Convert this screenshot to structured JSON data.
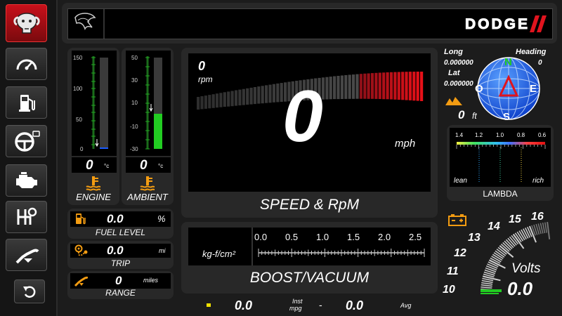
{
  "brand": {
    "name": "DODGE",
    "stripe_color": "#e0141e"
  },
  "sidebar": {
    "items": [
      {
        "icon": "ram-logo-icon",
        "active": true
      },
      {
        "icon": "gauge-icon"
      },
      {
        "icon": "fuel-pump-icon"
      },
      {
        "icon": "steering-wheel-icon"
      },
      {
        "icon": "engine-icon"
      },
      {
        "icon": "shifter-icon"
      },
      {
        "icon": "fuel-nozzle-icon"
      },
      {
        "icon": "back-arrow-icon"
      }
    ]
  },
  "engine_temp": {
    "scale": [
      "150",
      "100",
      "50",
      "0"
    ],
    "value": "0",
    "unit": "°c",
    "label": "ENGINE",
    "level": 0
  },
  "ambient_temp": {
    "scale": [
      "50",
      "30",
      "10",
      "-10",
      "-30"
    ],
    "value": "0",
    "unit": "°c",
    "label": "AMBIENT",
    "level": 0.38
  },
  "fuel": {
    "value": "0.0",
    "unit": "%",
    "label": "FUEL LEVEL"
  },
  "trip": {
    "value": "0.0",
    "unit": "mi",
    "label": "TRIP"
  },
  "range": {
    "value": "0",
    "unit": "miles",
    "label": "RANGE"
  },
  "speed": {
    "rpm_value": "0",
    "rpm_unit": "rpm",
    "speed_value": "0",
    "speed_unit": "mph",
    "title": "SPEED & RpM"
  },
  "boost": {
    "unit": "kg-f/cm²",
    "scale": [
      "0.0",
      "0.5",
      "1.0",
      "1.5",
      "2.0",
      "2.5"
    ],
    "title": "BOOST/VACUUM"
  },
  "gps": {
    "long_label": "Long",
    "long_value": "0.000000",
    "lat_label": "Lat",
    "lat_value": "0.000000",
    "heading_label": "Heading",
    "heading_value": "0",
    "altitude_value": "0",
    "altitude_unit": "ft",
    "compass": {
      "n": "N",
      "s": "S",
      "e": "E",
      "o": "O"
    }
  },
  "lambda": {
    "scale": [
      "1.4",
      "1.2",
      "1.0",
      "0.8",
      "0.6"
    ],
    "left_label": "lean",
    "right_label": "rich",
    "title": "LAMBDA"
  },
  "volts": {
    "scale": [
      "10",
      "11",
      "12",
      "13",
      "14",
      "15",
      "16"
    ],
    "label": "Volts",
    "value": "0.0"
  },
  "mpg": {
    "inst_value": "0.0",
    "inst_label": "Inst",
    "inst_unit": "mpg",
    "separator": "-",
    "avg_value": "0.0",
    "avg_label": "Avg"
  },
  "colors": {
    "accent_orange": "#f39c12",
    "green": "#22cc22",
    "red": "#e0141e",
    "blue": "#1a5cff"
  }
}
